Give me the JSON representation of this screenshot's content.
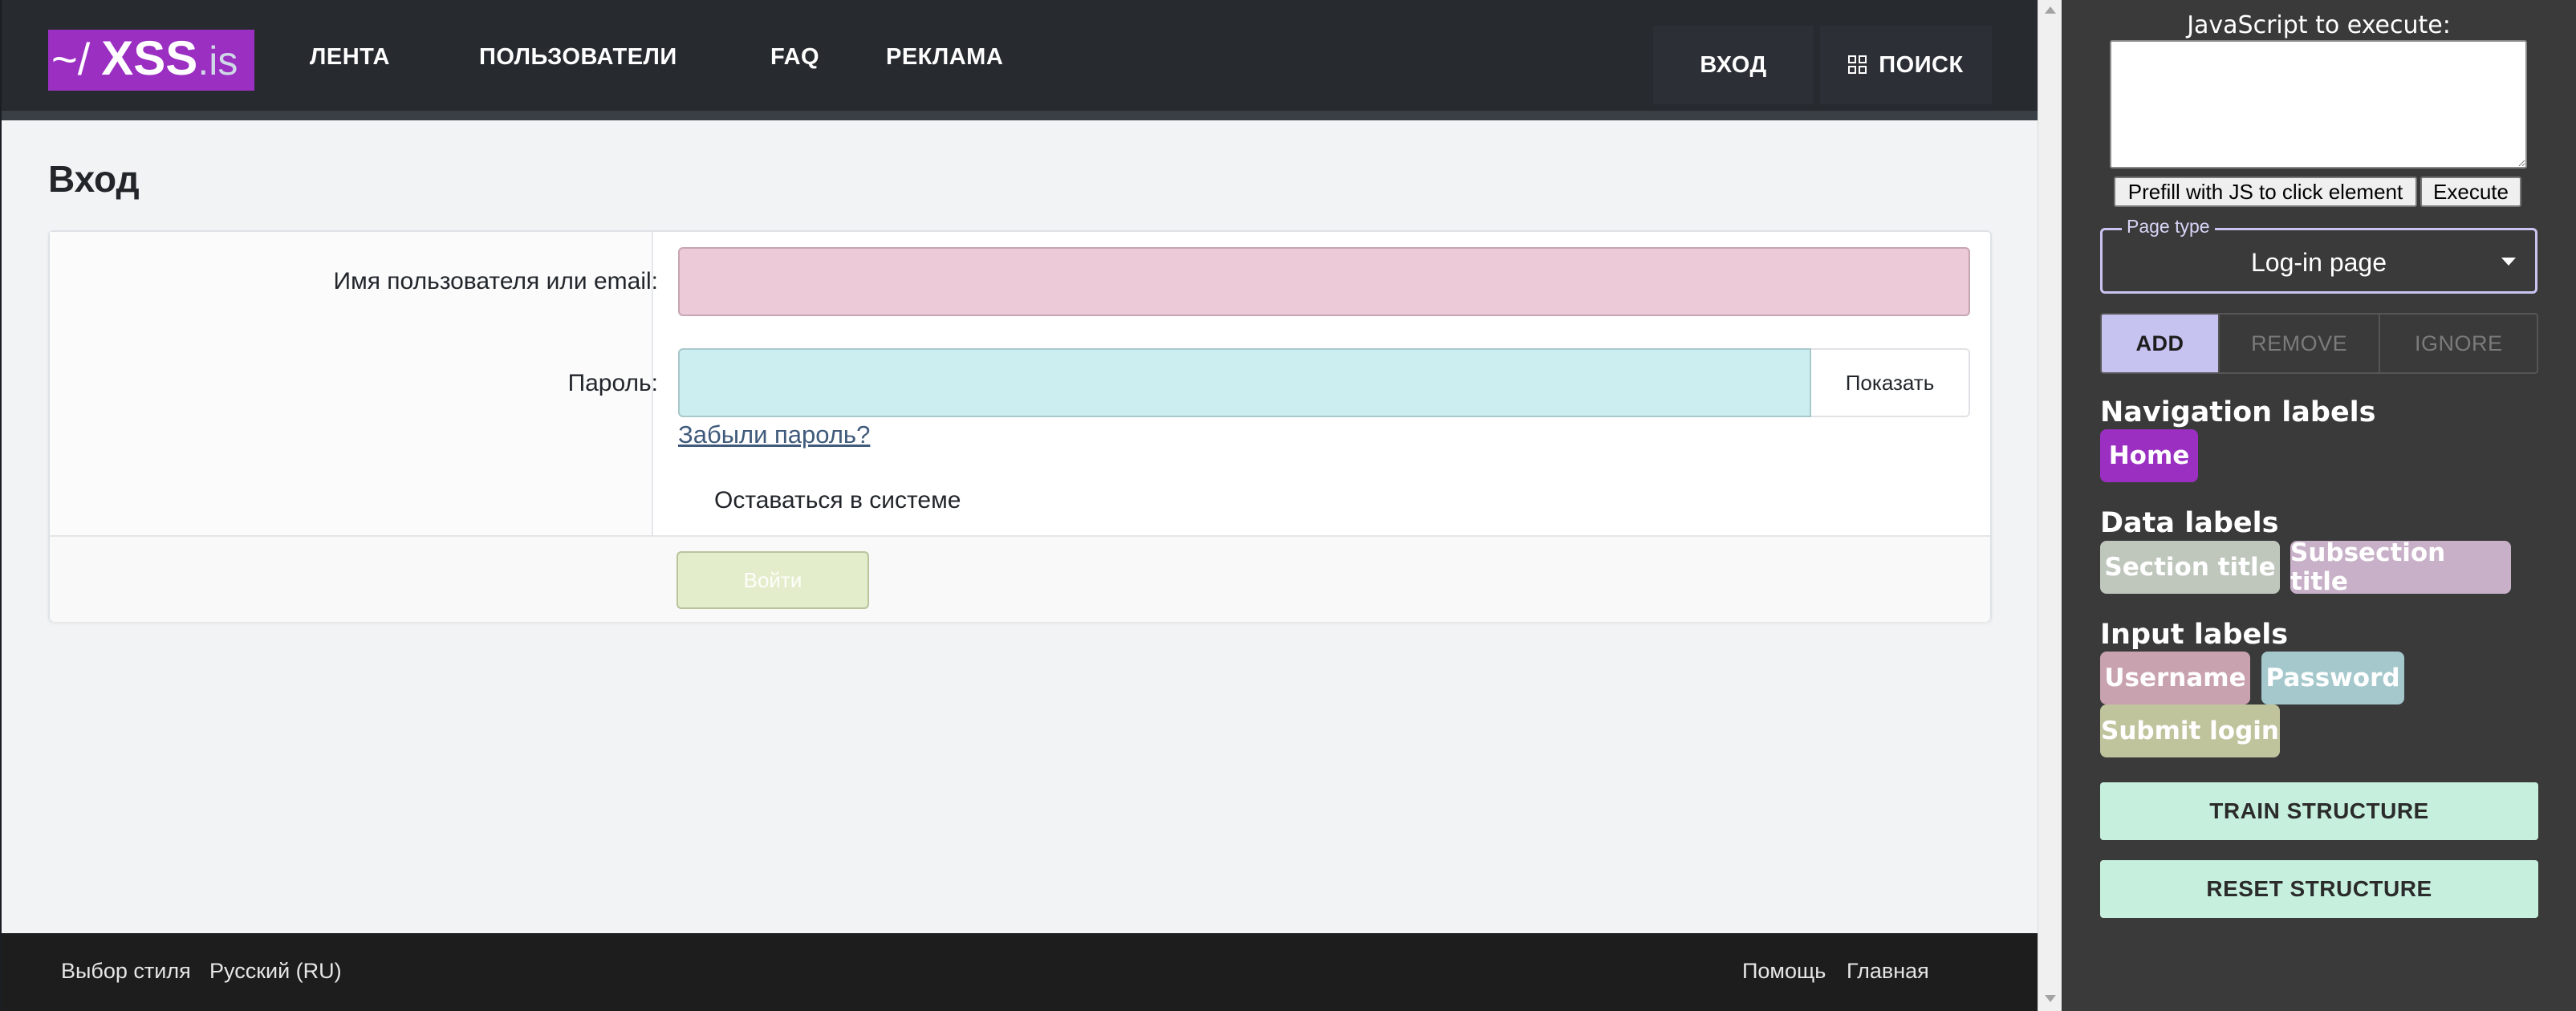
{
  "header": {
    "logo": {
      "prefix": "~/",
      "name": "XSS",
      "tld": ".is"
    },
    "nav": [
      "ЛЕНТА",
      "ПОЛЬЗОВАТЕЛИ",
      "FAQ",
      "РЕКЛАМА"
    ],
    "login_label": "ВХОД",
    "search_label": "ПОИСК"
  },
  "main": {
    "title": "Вход",
    "form": {
      "username_label": "Имя пользователя или email:",
      "username_value": "",
      "password_label": "Пароль:",
      "password_value": "",
      "show_label": "Показать",
      "forgot_label": "Забыли пароль?",
      "stay_label": "Оставаться в системе",
      "submit_label": "Войти"
    }
  },
  "footer": {
    "left": [
      "Выбор стиля",
      "Русский (RU)"
    ],
    "right": [
      "Помощь",
      "Главная"
    ]
  },
  "panel": {
    "js_label": "JavaScript to execute:",
    "js_value": "",
    "prefill_label": "Prefill with JS to click element",
    "execute_label": "Execute",
    "page_type_legend": "Page type",
    "page_type_value": "Log-in page",
    "actions": [
      "ADD",
      "REMOVE",
      "IGNORE"
    ],
    "navigation_title": "Navigation labels",
    "navigation_chips": [
      "Home"
    ],
    "data_title": "Data labels",
    "data_chips": [
      "Section title",
      "Subsection title"
    ],
    "input_title": "Input labels",
    "input_chips": [
      "Username",
      "Password",
      "Submit login"
    ],
    "train_label": "TRAIN STRUCTURE",
    "reset_label": "RESET STRUCTURE"
  },
  "colors": {
    "logo_bg": "#9a2fc2",
    "header_bg": "#272b30",
    "username_field": "#eccad8",
    "password_field": "#cdeef0",
    "submit_button": "#e4edcb",
    "panel_bg": "#3a3a3a",
    "chip_home": "#9a2fc2",
    "chip_section_title": "#bfc7bd",
    "chip_subsection_title": "#c8b1c8",
    "chip_username": "#c9a2b0",
    "chip_password": "#a5c8cc",
    "chip_submit_login": "#c0c49d",
    "action_active": "#c6c3f0",
    "structure_buttons": "#c6f0dd"
  },
  "icons": {
    "search": "grid-icon",
    "dropdown": "caret-down-icon",
    "scroll_up": "arrow-up-icon",
    "scroll_down": "arrow-down-icon"
  }
}
